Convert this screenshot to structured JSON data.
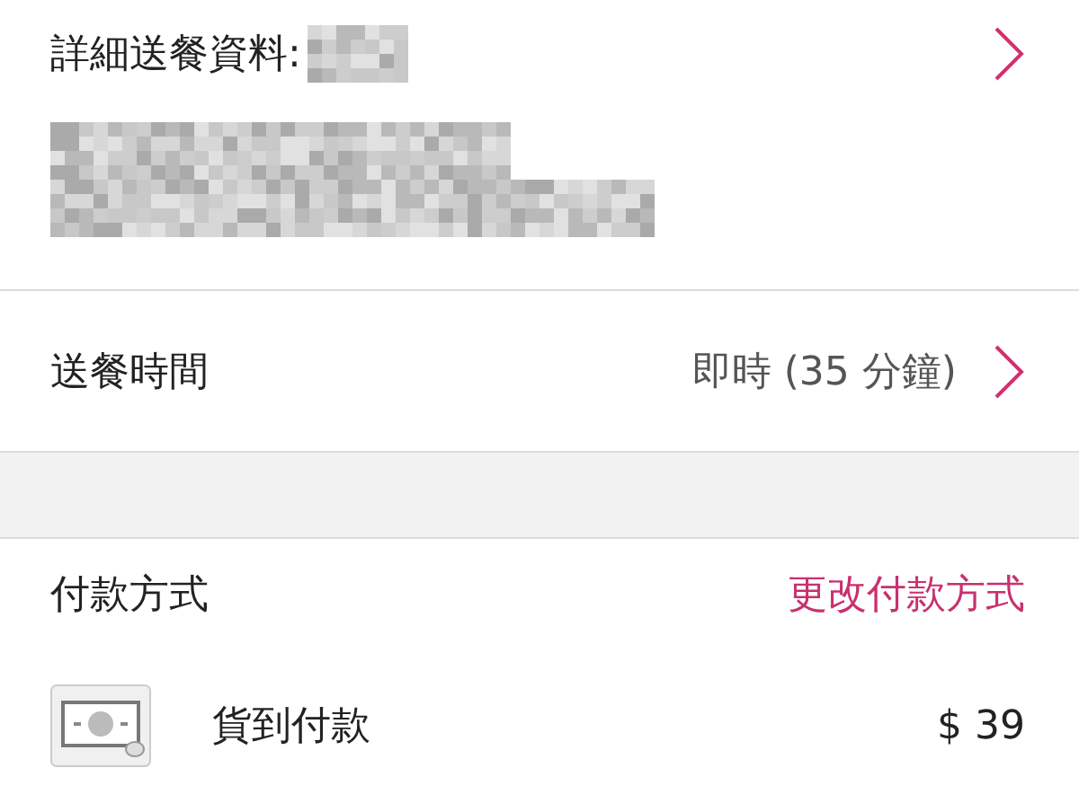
{
  "delivery_details": {
    "label": "詳細送餐資料:"
  },
  "delivery_time": {
    "label": "送餐時間",
    "value": "即時 (35 分鐘)"
  },
  "payment": {
    "label": "付款方式",
    "change_link": "更改付款方式"
  },
  "payment_method": {
    "name": "貨到付款",
    "amount": "$ 39"
  }
}
